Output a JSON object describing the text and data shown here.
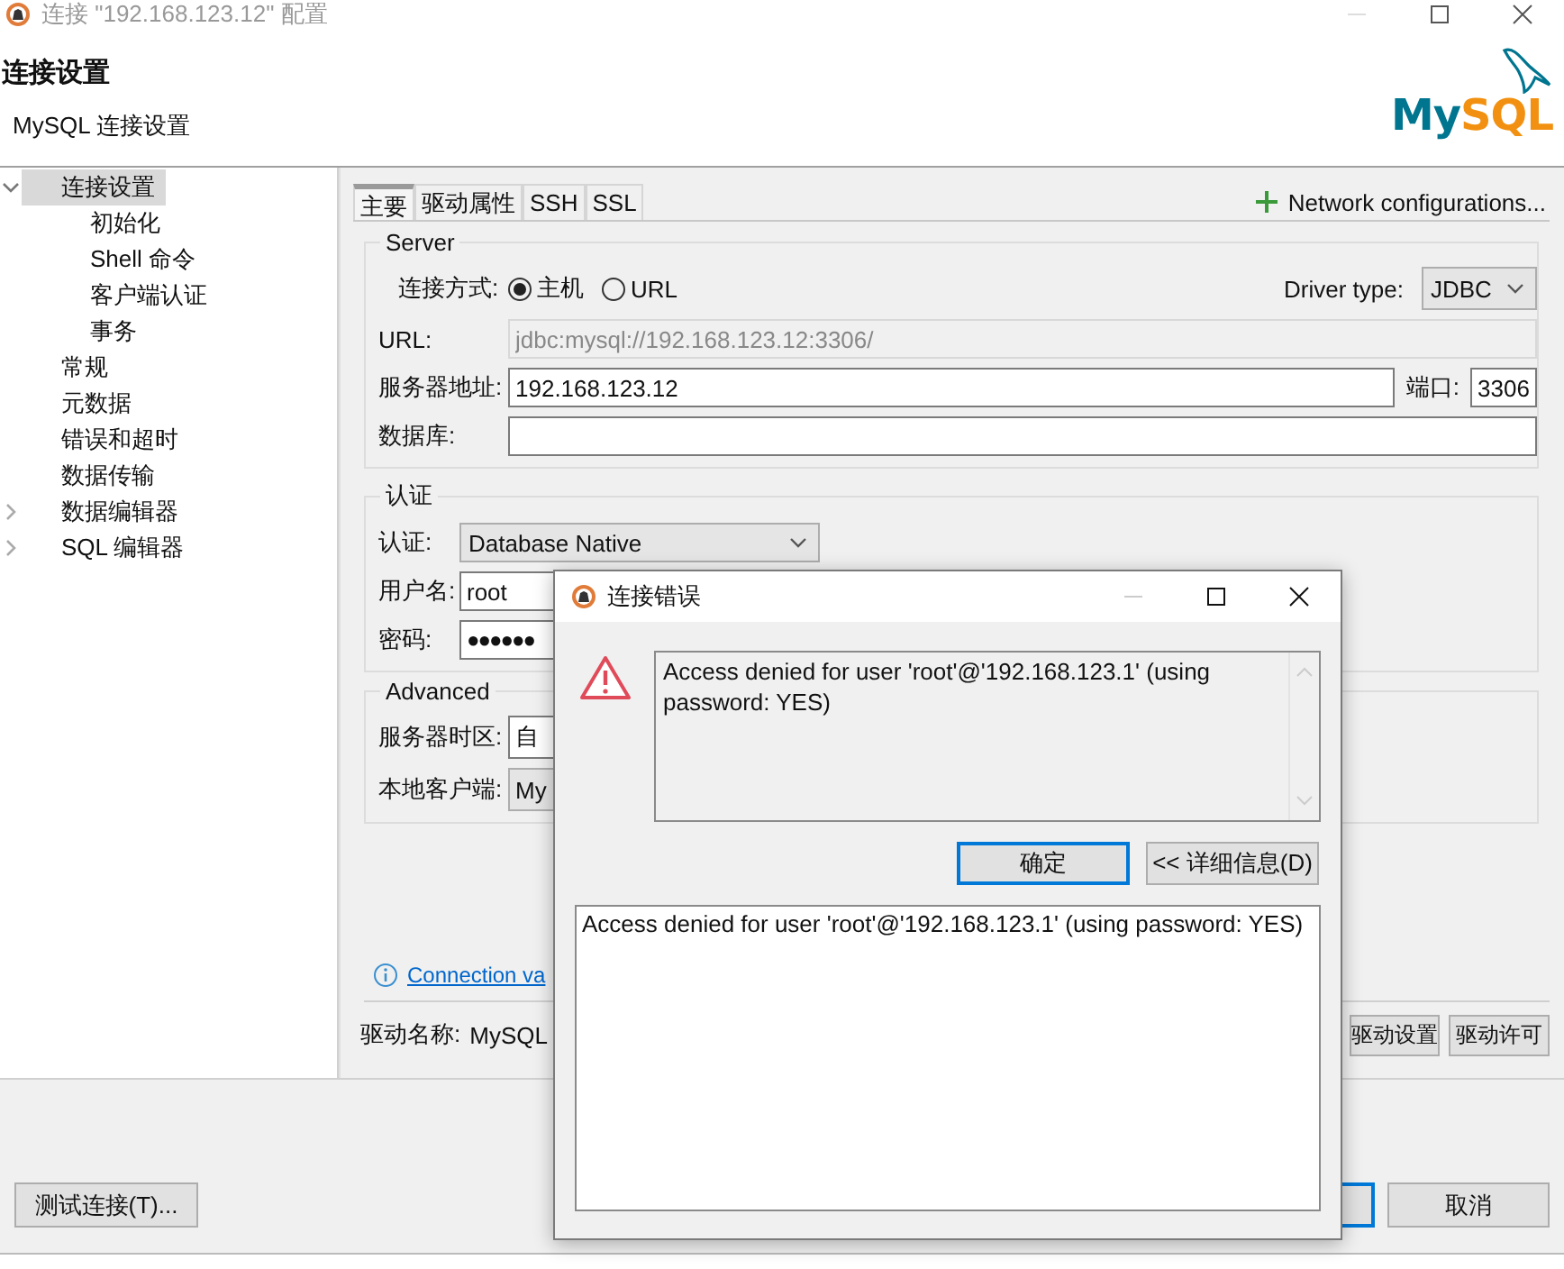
{
  "window": {
    "title": "连接 \"192.168.123.12\" 配置"
  },
  "header": {
    "title": "连接设置",
    "subtitle": "MySQL 连接设置",
    "logo_text": "MySQL"
  },
  "tree": [
    {
      "label": "连接设置",
      "selected": true,
      "expanded": true,
      "children": [
        {
          "label": "初始化",
          "selected": false
        },
        {
          "label": "Shell 命令",
          "selected": false
        },
        {
          "label": "客户端认证",
          "selected": false
        },
        {
          "label": "事务",
          "selected": false
        }
      ]
    },
    {
      "label": "常规",
      "selected": false
    },
    {
      "label": "元数据",
      "selected": false
    },
    {
      "label": "错误和超时",
      "selected": false
    },
    {
      "label": "数据传输",
      "selected": false
    },
    {
      "label": "数据编辑器",
      "selected": false,
      "expanded": false
    },
    {
      "label": "SQL 编辑器",
      "selected": false,
      "expanded": false
    }
  ],
  "tabs": [
    {
      "label": "主要",
      "selected": true
    },
    {
      "label": "驱动属性",
      "selected": false
    },
    {
      "label": "SSH",
      "selected": false
    },
    {
      "label": "SSL",
      "selected": false
    }
  ],
  "network_button": "Network configurations...",
  "server": {
    "legend": "Server",
    "method_label": "连接方式:",
    "methods": [
      {
        "label": "主机",
        "selected": true
      },
      {
        "label": "URL",
        "selected": false
      }
    ],
    "driver_type_label": "Driver type:",
    "driver_type": "JDBC",
    "url_label": "URL:",
    "url": "jdbc:mysql://192.168.123.12:3306/",
    "url_disabled": true,
    "host_label": "服务器地址:",
    "host": "192.168.123.12",
    "port_label": "端口:",
    "port": "3306",
    "database_label": "数据库:"
  },
  "auth": {
    "legend": "认证",
    "auth_label": "认证:",
    "auth": "Database Native",
    "user_label": "用户名:",
    "user": "root",
    "password_label": "密码:",
    "password": "●●●●●●"
  },
  "advanced": {
    "legend": "Advanced",
    "timezone_label": "服务器时区:",
    "timezone": "自",
    "client_label": "本地客户端:",
    "client": "My"
  },
  "link": "Connection va",
  "driver": {
    "label": "驱动名称:",
    "name": "MySQL",
    "buttons": [
      "驱动设置",
      "驱动许可"
    ]
  },
  "footer": {
    "test_button": "测试连接(T)...",
    "cancel_button": "取消"
  },
  "dialog": {
    "title": "连接错误",
    "message": "Access denied for user 'root'@'192.168.123.1' (using password: YES)",
    "buttons": [
      {
        "label": "确定",
        "default": true
      },
      {
        "label": "<< 详细信息(D)",
        "default": false
      }
    ],
    "details": "Access denied for user 'root'@'192.168.123.1' (using password: YES)"
  }
}
